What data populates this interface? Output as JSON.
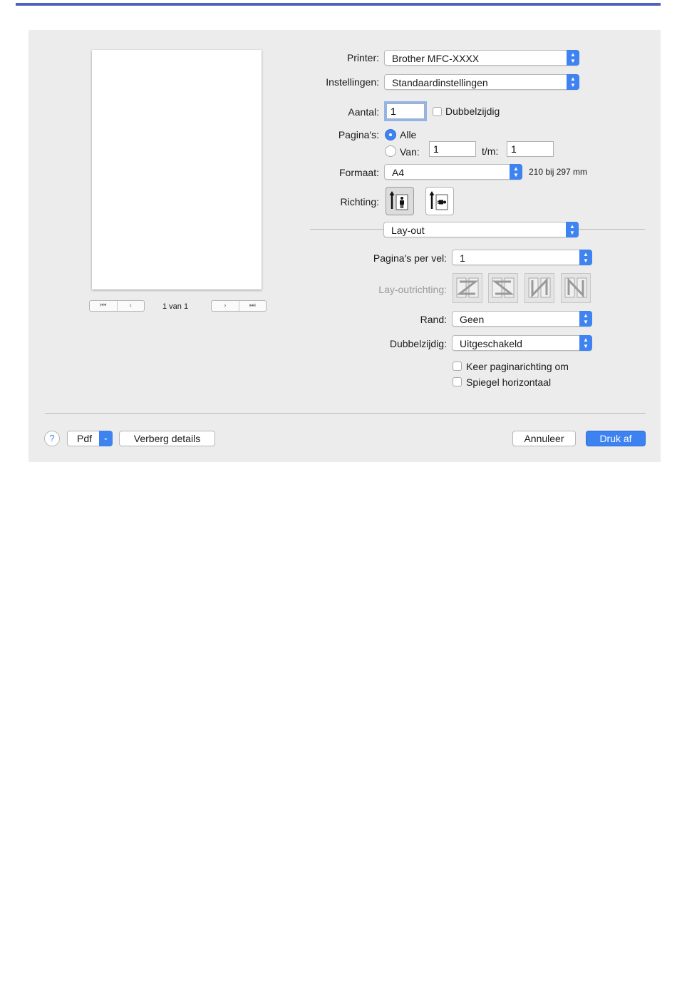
{
  "dialog": {
    "preview": {
      "page_info": "1 van 1",
      "nav_first": "⏮",
      "nav_prev": "‹",
      "nav_next": "›",
      "nav_last": "⏭"
    },
    "printer": {
      "label": "Printer:",
      "value": "Brother MFC-XXXX"
    },
    "presets": {
      "label": "Instellingen:",
      "value": "Standaardinstellingen"
    },
    "copies": {
      "label": "Aantal:",
      "value": "1",
      "duplex_label": "Dubbelzijdig"
    },
    "pages": {
      "label": "Pagina's:",
      "all_label": "Alle",
      "from_label": "Van:",
      "from_value": "1",
      "to_label": "t/m:",
      "to_value": "1"
    },
    "paper_size": {
      "label": "Formaat:",
      "value": "A4",
      "dimensions": "210 bij 297 mm"
    },
    "orientation": {
      "label": "Richting:",
      "portrait_icon": "portrait-orientation-icon",
      "landscape_icon": "landscape-orientation-icon"
    },
    "section": {
      "value": "Lay-out"
    },
    "layout": {
      "pages_per_sheet": {
        "label": "Pagina's per vel:",
        "value": "1"
      },
      "direction": {
        "label": "Lay-outrichting:"
      },
      "border": {
        "label": "Rand:",
        "value": "Geen"
      },
      "two_sided": {
        "label": "Dubbelzijdig:",
        "value": "Uitgeschakeld"
      },
      "reverse_label": "Keer paginarichting om",
      "flip_label": "Spiegel horizontaal"
    },
    "footer": {
      "help": "?",
      "pdf_label": "Pdf",
      "hide_details": "Verberg details",
      "cancel": "Annuleer",
      "print": "Druk af"
    }
  },
  "colors": {
    "accent": "#3f83f1",
    "top_rule": "#4e62b8",
    "dialog_bg": "#ececec"
  }
}
